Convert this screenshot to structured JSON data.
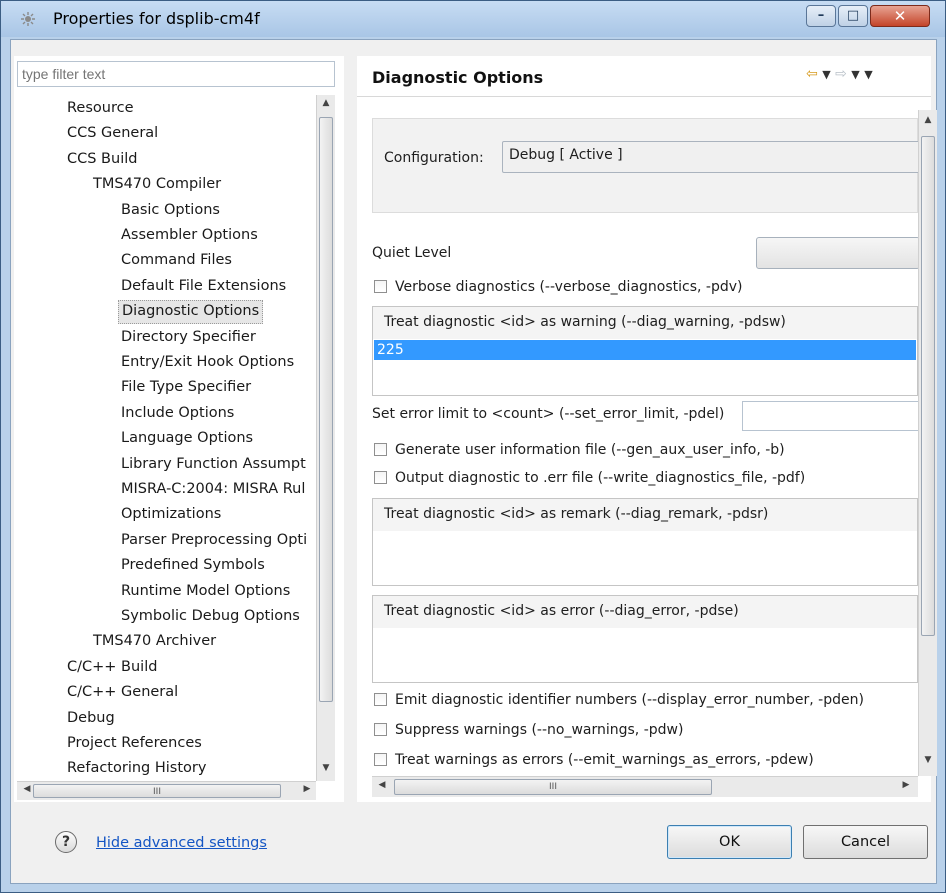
{
  "window": {
    "title": "Properties for dsplib-cm4f",
    "buttons": {
      "minimize": "–",
      "maximize": "□",
      "close": "✕"
    }
  },
  "left": {
    "filter_placeholder": "type filter text",
    "tree": [
      {
        "label": "Resource",
        "indent": 0,
        "selected": false
      },
      {
        "label": "CCS General",
        "indent": 0,
        "selected": false
      },
      {
        "label": "CCS Build",
        "indent": 0,
        "selected": false
      },
      {
        "label": "TMS470 Compiler",
        "indent": 1,
        "selected": false
      },
      {
        "label": "Basic Options",
        "indent": 2,
        "selected": false
      },
      {
        "label": "Assembler Options",
        "indent": 2,
        "selected": false
      },
      {
        "label": "Command Files",
        "indent": 2,
        "selected": false
      },
      {
        "label": "Default File Extensions",
        "indent": 2,
        "selected": false
      },
      {
        "label": "Diagnostic Options",
        "indent": 2,
        "selected": true
      },
      {
        "label": "Directory Specifier",
        "indent": 2,
        "selected": false
      },
      {
        "label": "Entry/Exit Hook Options",
        "indent": 2,
        "selected": false
      },
      {
        "label": "File Type Specifier",
        "indent": 2,
        "selected": false
      },
      {
        "label": "Include Options",
        "indent": 2,
        "selected": false
      },
      {
        "label": "Language Options",
        "indent": 2,
        "selected": false
      },
      {
        "label": "Library Function Assumpt",
        "indent": 2,
        "selected": false
      },
      {
        "label": "MISRA-C:2004: MISRA Rul",
        "indent": 2,
        "selected": false
      },
      {
        "label": "Optimizations",
        "indent": 2,
        "selected": false
      },
      {
        "label": "Parser Preprocessing Opti",
        "indent": 2,
        "selected": false
      },
      {
        "label": "Predefined Symbols",
        "indent": 2,
        "selected": false
      },
      {
        "label": "Runtime Model Options",
        "indent": 2,
        "selected": false
      },
      {
        "label": "Symbolic Debug Options",
        "indent": 2,
        "selected": false
      },
      {
        "label": "TMS470 Archiver",
        "indent": 1,
        "selected": false
      },
      {
        "label": "C/C++ Build",
        "indent": 0,
        "selected": false
      },
      {
        "label": "C/C++ General",
        "indent": 0,
        "selected": false
      },
      {
        "label": "Debug",
        "indent": 0,
        "selected": false
      },
      {
        "label": "Project References",
        "indent": 0,
        "selected": false
      },
      {
        "label": "Refactoring History",
        "indent": 0,
        "selected": false
      }
    ]
  },
  "right": {
    "title": "Diagnostic Options",
    "config_label": "Configuration:",
    "config_value": "Debug  [ Active ]",
    "quiet_level_label": "Quiet Level",
    "verbose": "Verbose diagnostics (--verbose_diagnostics, -pdv)",
    "diag_warning": {
      "header": "Treat diagnostic <id> as warning (--diag_warning, -pdsw)",
      "items": [
        "225"
      ]
    },
    "error_limit_label": "Set error limit to <count> (--set_error_limit, -pdel)",
    "gen_aux": "Generate user information file (--gen_aux_user_info, -b)",
    "write_diag": "Output diagnostic to .err file (--write_diagnostics_file, -pdf)",
    "diag_remark": {
      "header": "Treat diagnostic <id> as remark (--diag_remark, -pdsr)"
    },
    "diag_error": {
      "header": "Treat diagnostic <id> as error (--diag_error, -pdse)"
    },
    "display_error": "Emit diagnostic identifier numbers (--display_error_number, -pden)",
    "no_warnings": "Suppress warnings (--no_warnings, -pdw)",
    "warn_as_errors": "Treat warnings as errors (--emit_warnings_as_errors, -pdew)"
  },
  "bottom": {
    "help_icon": "?",
    "hide_advanced": "Hide advanced settings",
    "ok": "OK",
    "cancel": "Cancel"
  },
  "colors": {
    "selection": "#3399ff",
    "link": "#1556c4",
    "titlebar": "#b9d1ea"
  }
}
